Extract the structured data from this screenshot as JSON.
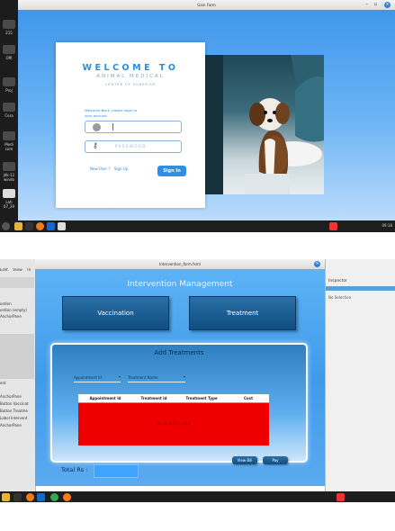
{
  "top_window": {
    "title": "Gain Form",
    "desktop_labels": [
      "215",
      "Offi",
      "Proj",
      "Cera",
      "Medi\ncom",
      "Jdk-11\nwindo",
      "Lati\n07_29"
    ],
    "login": {
      "welcome": "WELCOME TO",
      "org": "ANIMAL MEDICAL",
      "sub": "CENTER OF SURPRISE",
      "prompt_line1": "Welcome Back, please login to",
      "prompt_line2": "your account",
      "password_placeholder": "PASSWORD",
      "new_user_text": "New User ?",
      "signup_link": "Sign Up",
      "signin_button": "Sign In"
    },
    "taskbar_clock": "09:18"
  },
  "bottom_window": {
    "ide_menu": [
      "Edit",
      "View",
      "In"
    ],
    "left_panel": [
      "ordion",
      "ordion  (empty)",
      "AnchorPane",
      "ent",
      "AnchorPane",
      "Button  Vaccinat",
      "Button  Treatme",
      "Label  Intervent",
      "AnchorPane"
    ],
    "inspector_title": "Inspector",
    "inspector_empty": "No Selection",
    "title": "Intervention_form.fxml",
    "heading": "Intervention Management",
    "vaccination_button": "Vaccination",
    "treatment_button": "Treatment",
    "panel_title": "Add Treatments",
    "appointment_combo": "Appointment Id",
    "treatment_combo": "Treatment Name",
    "table_headers": [
      "Appointment Id",
      "Treatment Id",
      "Treatment Type",
      "Cost"
    ],
    "table_empty": "No content in table",
    "view_bill_button": "View Bill",
    "pay_button": "Pay",
    "total_label": "Total Rs :"
  },
  "colors": {
    "sky_blue": "#5aa9ee",
    "sign_in": "#2e8fe6",
    "dark_tile": "#0f4d82",
    "table_red": "#ee0000",
    "total_field": "#3fa3ff"
  }
}
